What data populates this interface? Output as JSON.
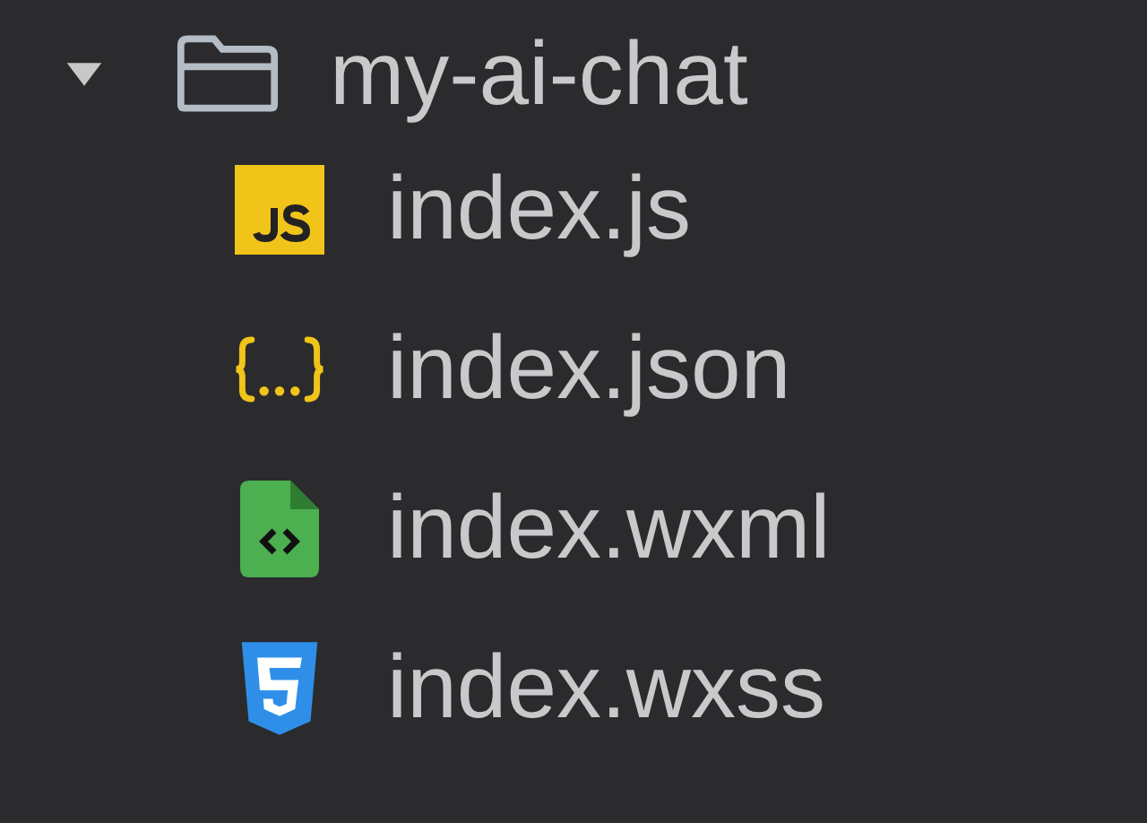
{
  "tree": {
    "name": "my-ai-chat",
    "expanded": true,
    "children": [
      {
        "name": "index.js",
        "kind": "js"
      },
      {
        "name": "index.json",
        "kind": "json"
      },
      {
        "name": "index.wxml",
        "kind": "wxml"
      },
      {
        "name": "index.wxss",
        "kind": "wxss"
      }
    ]
  }
}
